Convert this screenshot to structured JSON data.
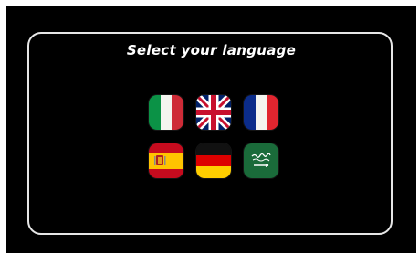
{
  "title": "Select your language",
  "flags": [
    {
      "id": "it",
      "icon": "italy-flag-icon"
    },
    {
      "id": "gb",
      "icon": "united-kingdom-flag-icon"
    },
    {
      "id": "fr",
      "icon": "france-flag-icon"
    },
    {
      "id": "es",
      "icon": "spain-flag-icon"
    },
    {
      "id": "de",
      "icon": "germany-flag-icon"
    },
    {
      "id": "sa",
      "icon": "saudi-arabia-flag-icon"
    }
  ],
  "colors": {
    "background": "#000000",
    "panel_border": "#e6e6e6",
    "title_text": "#ffffff"
  }
}
